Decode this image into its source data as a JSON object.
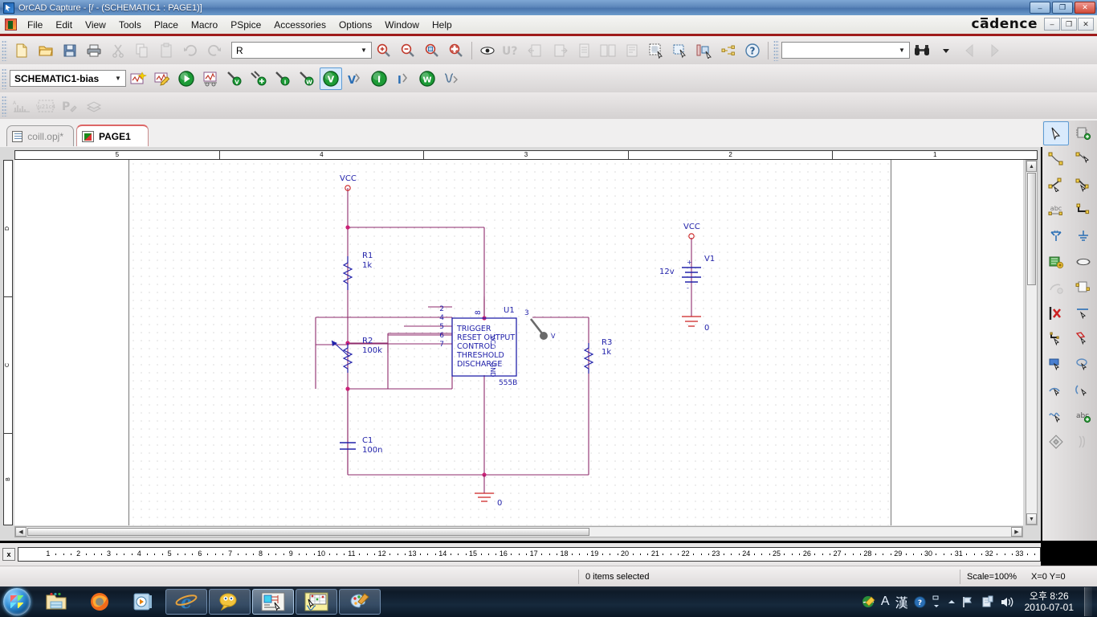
{
  "window": {
    "title": "OrCAD Capture - [/ - (SCHEMATIC1 : PAGE1)]",
    "minimize": "–",
    "maximize": "❐",
    "close": "✕",
    "brand": "cadence",
    "mdi_minimize": "–",
    "mdi_restore": "❐",
    "mdi_close": "✕"
  },
  "menu": {
    "items": [
      "File",
      "Edit",
      "View",
      "Tools",
      "Place",
      "Macro",
      "PSpice",
      "Accessories",
      "Options",
      "Window",
      "Help"
    ]
  },
  "toolbar_main": {
    "buttons": [
      {
        "name": "new-icon",
        "label": "New"
      },
      {
        "name": "open-icon",
        "label": "Open"
      },
      {
        "name": "save-icon",
        "label": "Save"
      },
      {
        "name": "print-icon",
        "label": "Print"
      },
      {
        "name": "cut-icon",
        "label": "Cut"
      },
      {
        "name": "copy-icon",
        "label": "Copy"
      },
      {
        "name": "paste-icon",
        "label": "Paste"
      },
      {
        "name": "undo-icon",
        "label": "Undo"
      },
      {
        "name": "redo-icon",
        "label": "Redo"
      }
    ],
    "part_combo_value": "R",
    "zoom_buttons": [
      "zoom-in-icon",
      "zoom-out-icon",
      "zoom-area-icon",
      "zoom-all-icon"
    ],
    "other_buttons": [
      "snap-to-grid-icon",
      "annotate-icon",
      "backannotate-icon",
      "export-icon",
      "bom-icon",
      "drc-icon",
      "netlist-icon",
      "cis-explorer-icon",
      "select-filter-icon",
      "project-manager-icon",
      "hierarchy-icon",
      "help-icon"
    ],
    "search_value": "",
    "search_buttons": [
      "binoculars-icon",
      "search-dropdown-icon",
      "previous-icon",
      "next-icon"
    ]
  },
  "toolbar_pspice": {
    "profile_value": "SCHEMATIC1-bias",
    "buttons": [
      {
        "name": "new-simulation-profile-icon",
        "label": "New Simulation Profile"
      },
      {
        "name": "edit-simulation-profile-icon",
        "label": "Edit Simulation Profile"
      },
      {
        "name": "run-pspice-icon",
        "label": "Run PSpice"
      },
      {
        "name": "view-simulation-results-icon",
        "label": "View Simulation Results"
      },
      {
        "name": "voltage-marker-icon",
        "label": "Voltage/Level Marker"
      },
      {
        "name": "voltage-differential-marker-icon",
        "label": "Voltage Differential Markers"
      },
      {
        "name": "current-marker-icon",
        "label": "Current Marker"
      },
      {
        "name": "power-marker-icon",
        "label": "Power Dissipation Marker"
      },
      {
        "name": "enable-bias-voltage-display-icon",
        "label": "Enable Bias Voltage Display"
      },
      {
        "name": "toggle-voltage-display-icon",
        "label": "Toggle Voltage Display"
      },
      {
        "name": "enable-bias-current-display-icon",
        "label": "Enable Bias Current Display"
      },
      {
        "name": "toggle-current-display-icon",
        "label": "Toggle Current Display"
      },
      {
        "name": "enable-power-display-icon",
        "label": "Enable Power Display"
      },
      {
        "name": "toggle-power-display-icon",
        "label": "Toggle Power Display"
      }
    ],
    "selected_button": "enable-bias-voltage-display-icon"
  },
  "toolbar_third": {
    "buttons": [
      {
        "name": "probe-window-icon",
        "label": "Probe Window"
      },
      {
        "name": "model-editor-icon",
        "label": "Model Editor"
      },
      {
        "name": "stimulus-editor-icon",
        "label": "Stimulus Editor"
      },
      {
        "name": "library-icon",
        "label": "Library"
      }
    ]
  },
  "tabs": [
    {
      "label": "coill.opj*",
      "active": false,
      "name": "tab-project"
    },
    {
      "label": "PAGE1",
      "active": true,
      "name": "tab-page1"
    }
  ],
  "ruler": {
    "top_labels": [
      "5",
      "4",
      "3",
      "2",
      "1"
    ],
    "left_labels": [
      "D",
      "C",
      "B"
    ],
    "bottom_numbers": [
      1,
      2,
      3,
      4,
      5,
      6,
      7,
      8,
      9,
      10,
      11,
      12,
      13,
      14,
      15,
      16,
      17,
      18,
      19,
      20,
      21,
      22,
      23,
      24,
      25,
      26,
      27,
      28,
      29,
      30,
      31,
      32,
      33
    ],
    "corner_label": "x"
  },
  "schematic": {
    "nets": [
      {
        "name": "vcc-net-left",
        "label": "VCC"
      },
      {
        "name": "vcc-net-right",
        "label": "VCC"
      }
    ],
    "components": [
      {
        "ref": "R1",
        "value": "1k",
        "type": "resistor"
      },
      {
        "ref": "R2",
        "value": "100k",
        "type": "potentiometer"
      },
      {
        "ref": "R3",
        "value": "1k",
        "type": "resistor"
      },
      {
        "ref": "C1",
        "value": "100n",
        "type": "capacitor"
      },
      {
        "ref": "V1",
        "value": "12v",
        "type": "dc-source"
      },
      {
        "ref": "U1",
        "value": "555B",
        "type": "ic"
      }
    ],
    "ic": {
      "ref": "U1",
      "part": "555B",
      "top_pin": "8",
      "top_pin_label": "VCC",
      "bottom_pin_label": "GND",
      "left_pins": [
        {
          "num": "2",
          "label": "TRIGGER"
        },
        {
          "num": "4",
          "label": "RESET"
        },
        {
          "num": "5",
          "label": "CONTROL"
        },
        {
          "num": "6",
          "label": "THRESHOLD"
        },
        {
          "num": "7",
          "label": "DISCHARGE"
        }
      ],
      "right_pins": [
        {
          "num": "3",
          "label": "OUTPUT"
        }
      ]
    },
    "ground_labels": [
      "0",
      "0"
    ],
    "marker": {
      "name": "voltage-marker",
      "glyph": "V"
    },
    "colors": {
      "wire": "#8e2a6b",
      "part": "#2222aa",
      "pin": "#cc2222",
      "text": "#2222aa",
      "junction": "#cc2277"
    }
  },
  "palette": {
    "buttons": [
      {
        "name": "select-tool-icon",
        "selected": true
      },
      {
        "name": "place-part-icon",
        "selected": false
      },
      {
        "name": "place-wire-icon",
        "selected": false
      },
      {
        "name": "place-net-alias-icon",
        "selected": false
      },
      {
        "name": "place-bus-icon",
        "selected": false
      },
      {
        "name": "place-junction-icon",
        "selected": false
      },
      {
        "name": "place-bus-entry-icon",
        "selected": false
      },
      {
        "name": "place-net-alias-abc-icon",
        "selected": false
      },
      {
        "name": "place-power-icon",
        "selected": false
      },
      {
        "name": "place-ground-icon",
        "selected": false
      },
      {
        "name": "place-off-page-connector-icon",
        "selected": false
      },
      {
        "name": "place-hierarchical-block-icon",
        "selected": false
      },
      {
        "name": "place-hierarchical-port-icon",
        "selected": false
      },
      {
        "name": "place-hierarchical-pin-icon",
        "selected": false
      },
      {
        "name": "place-no-connect-icon",
        "selected": false
      },
      {
        "name": "place-line-icon",
        "selected": false
      },
      {
        "name": "place-polyline-icon",
        "selected": false
      },
      {
        "name": "place-rectangle-icon",
        "selected": false
      },
      {
        "name": "place-ellipse-icon",
        "selected": false
      },
      {
        "name": "place-arc-icon",
        "selected": false
      },
      {
        "name": "place-elliptical-arc-icon",
        "selected": false
      },
      {
        "name": "place-bezier-icon",
        "selected": false
      },
      {
        "name": "place-text-icon",
        "selected": false
      },
      {
        "name": "place-picture-icon",
        "selected": false
      },
      {
        "name": "zoom-selection-icon",
        "selected": false
      }
    ]
  },
  "status": {
    "selection": "0 items selected",
    "scale": "Scale=100%",
    "coords": "X=0  Y=0"
  },
  "taskbar": {
    "start_name": "start-button",
    "quick_launch": [
      {
        "name": "explorer-icon",
        "label": "Windows Explorer"
      },
      {
        "name": "firefox-icon",
        "label": "Mozilla Firefox"
      },
      {
        "name": "media-player-icon",
        "label": "Windows Media Player"
      }
    ],
    "windows": [
      {
        "name": "internet-explorer-window",
        "label": "Internet Explorer"
      },
      {
        "name": "messenger-window",
        "label": "Messenger"
      },
      {
        "name": "orcad-capture-window",
        "label": "OrCAD Capture",
        "active": true
      },
      {
        "name": "pspice-window",
        "label": "PSpice"
      },
      {
        "name": "paint-window",
        "label": "Paint"
      }
    ],
    "tray": {
      "ime_lang": "A",
      "ime_mode": "漢",
      "help": "?",
      "clock_time": "오후 8:26",
      "clock_date": "2010-07-01"
    }
  }
}
